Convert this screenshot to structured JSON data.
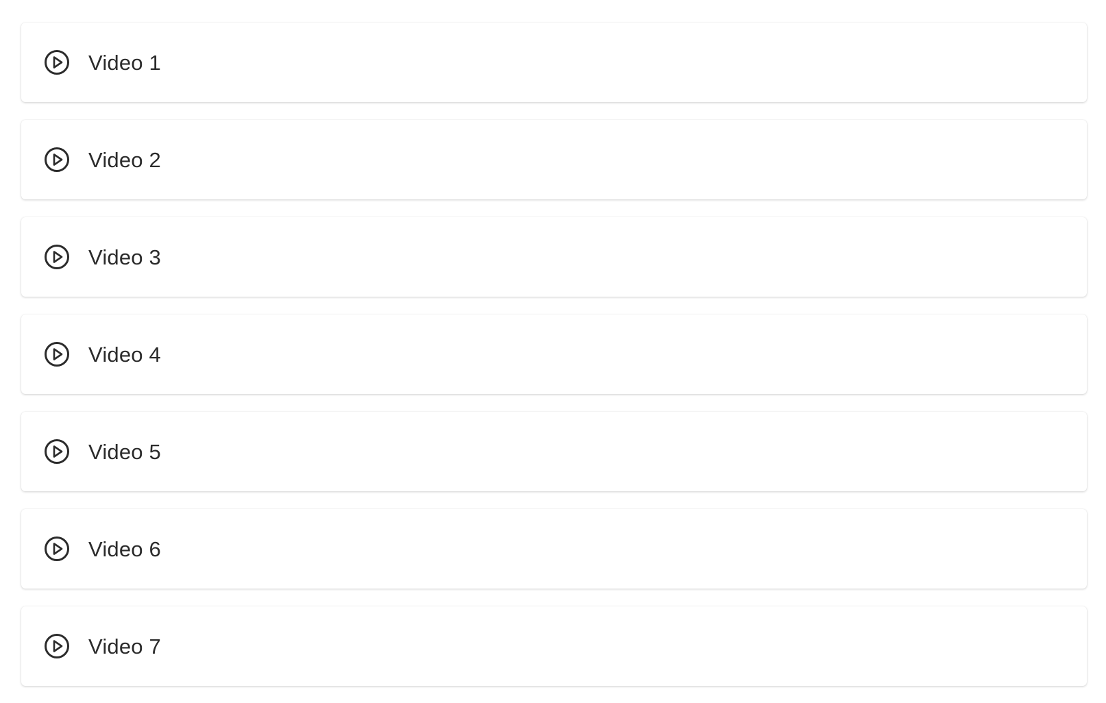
{
  "videos": [
    {
      "label": "Video 1",
      "icon": "play-circle-icon"
    },
    {
      "label": "Video 2",
      "icon": "play-circle-icon"
    },
    {
      "label": "Video 3",
      "icon": "play-circle-icon"
    },
    {
      "label": "Video 4",
      "icon": "play-circle-icon"
    },
    {
      "label": "Video 5",
      "icon": "play-circle-icon"
    },
    {
      "label": "Video 6",
      "icon": "play-circle-icon"
    },
    {
      "label": "Video 7",
      "icon": "play-circle-icon"
    }
  ],
  "colors": {
    "text": "#2b2b2b",
    "icon": "#2b2b2b",
    "card_background": "#ffffff",
    "page_background": "#ffffff"
  }
}
